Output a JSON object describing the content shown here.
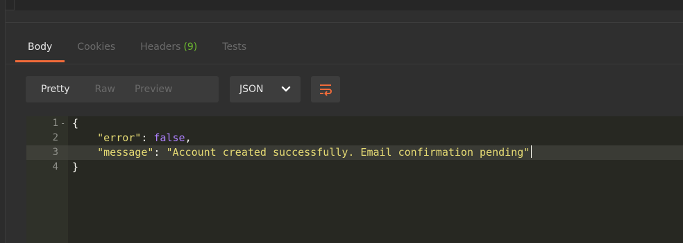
{
  "tabs": [
    {
      "label": "Body",
      "active": true
    },
    {
      "label": "Cookies",
      "active": false
    },
    {
      "label": "Headers",
      "count": "(9)",
      "active": false
    },
    {
      "label": "Tests",
      "active": false
    }
  ],
  "view_modes": [
    {
      "label": "Pretty",
      "active": true
    },
    {
      "label": "Raw",
      "active": false
    },
    {
      "label": "Preview",
      "active": false
    }
  ],
  "format_select": {
    "value": "JSON"
  },
  "wrap_button": {
    "icon": "wrap-lines-icon",
    "color": "#f26b3a"
  },
  "editor": {
    "lines": [
      {
        "number": "1",
        "fold": "-",
        "text": "{"
      },
      {
        "number": "2",
        "key": "\"error\"",
        "value": "false"
      },
      {
        "number": "3",
        "key": "\"message\"",
        "value": "\"Account created successfully. Email confirmation pending\""
      },
      {
        "number": "4",
        "text": "}"
      }
    ]
  },
  "colors": {
    "accent": "#f26b3a",
    "count_green": "#6dbb2f",
    "string_yellow": "#e6db74",
    "boolean_purple": "#ae81ff"
  }
}
